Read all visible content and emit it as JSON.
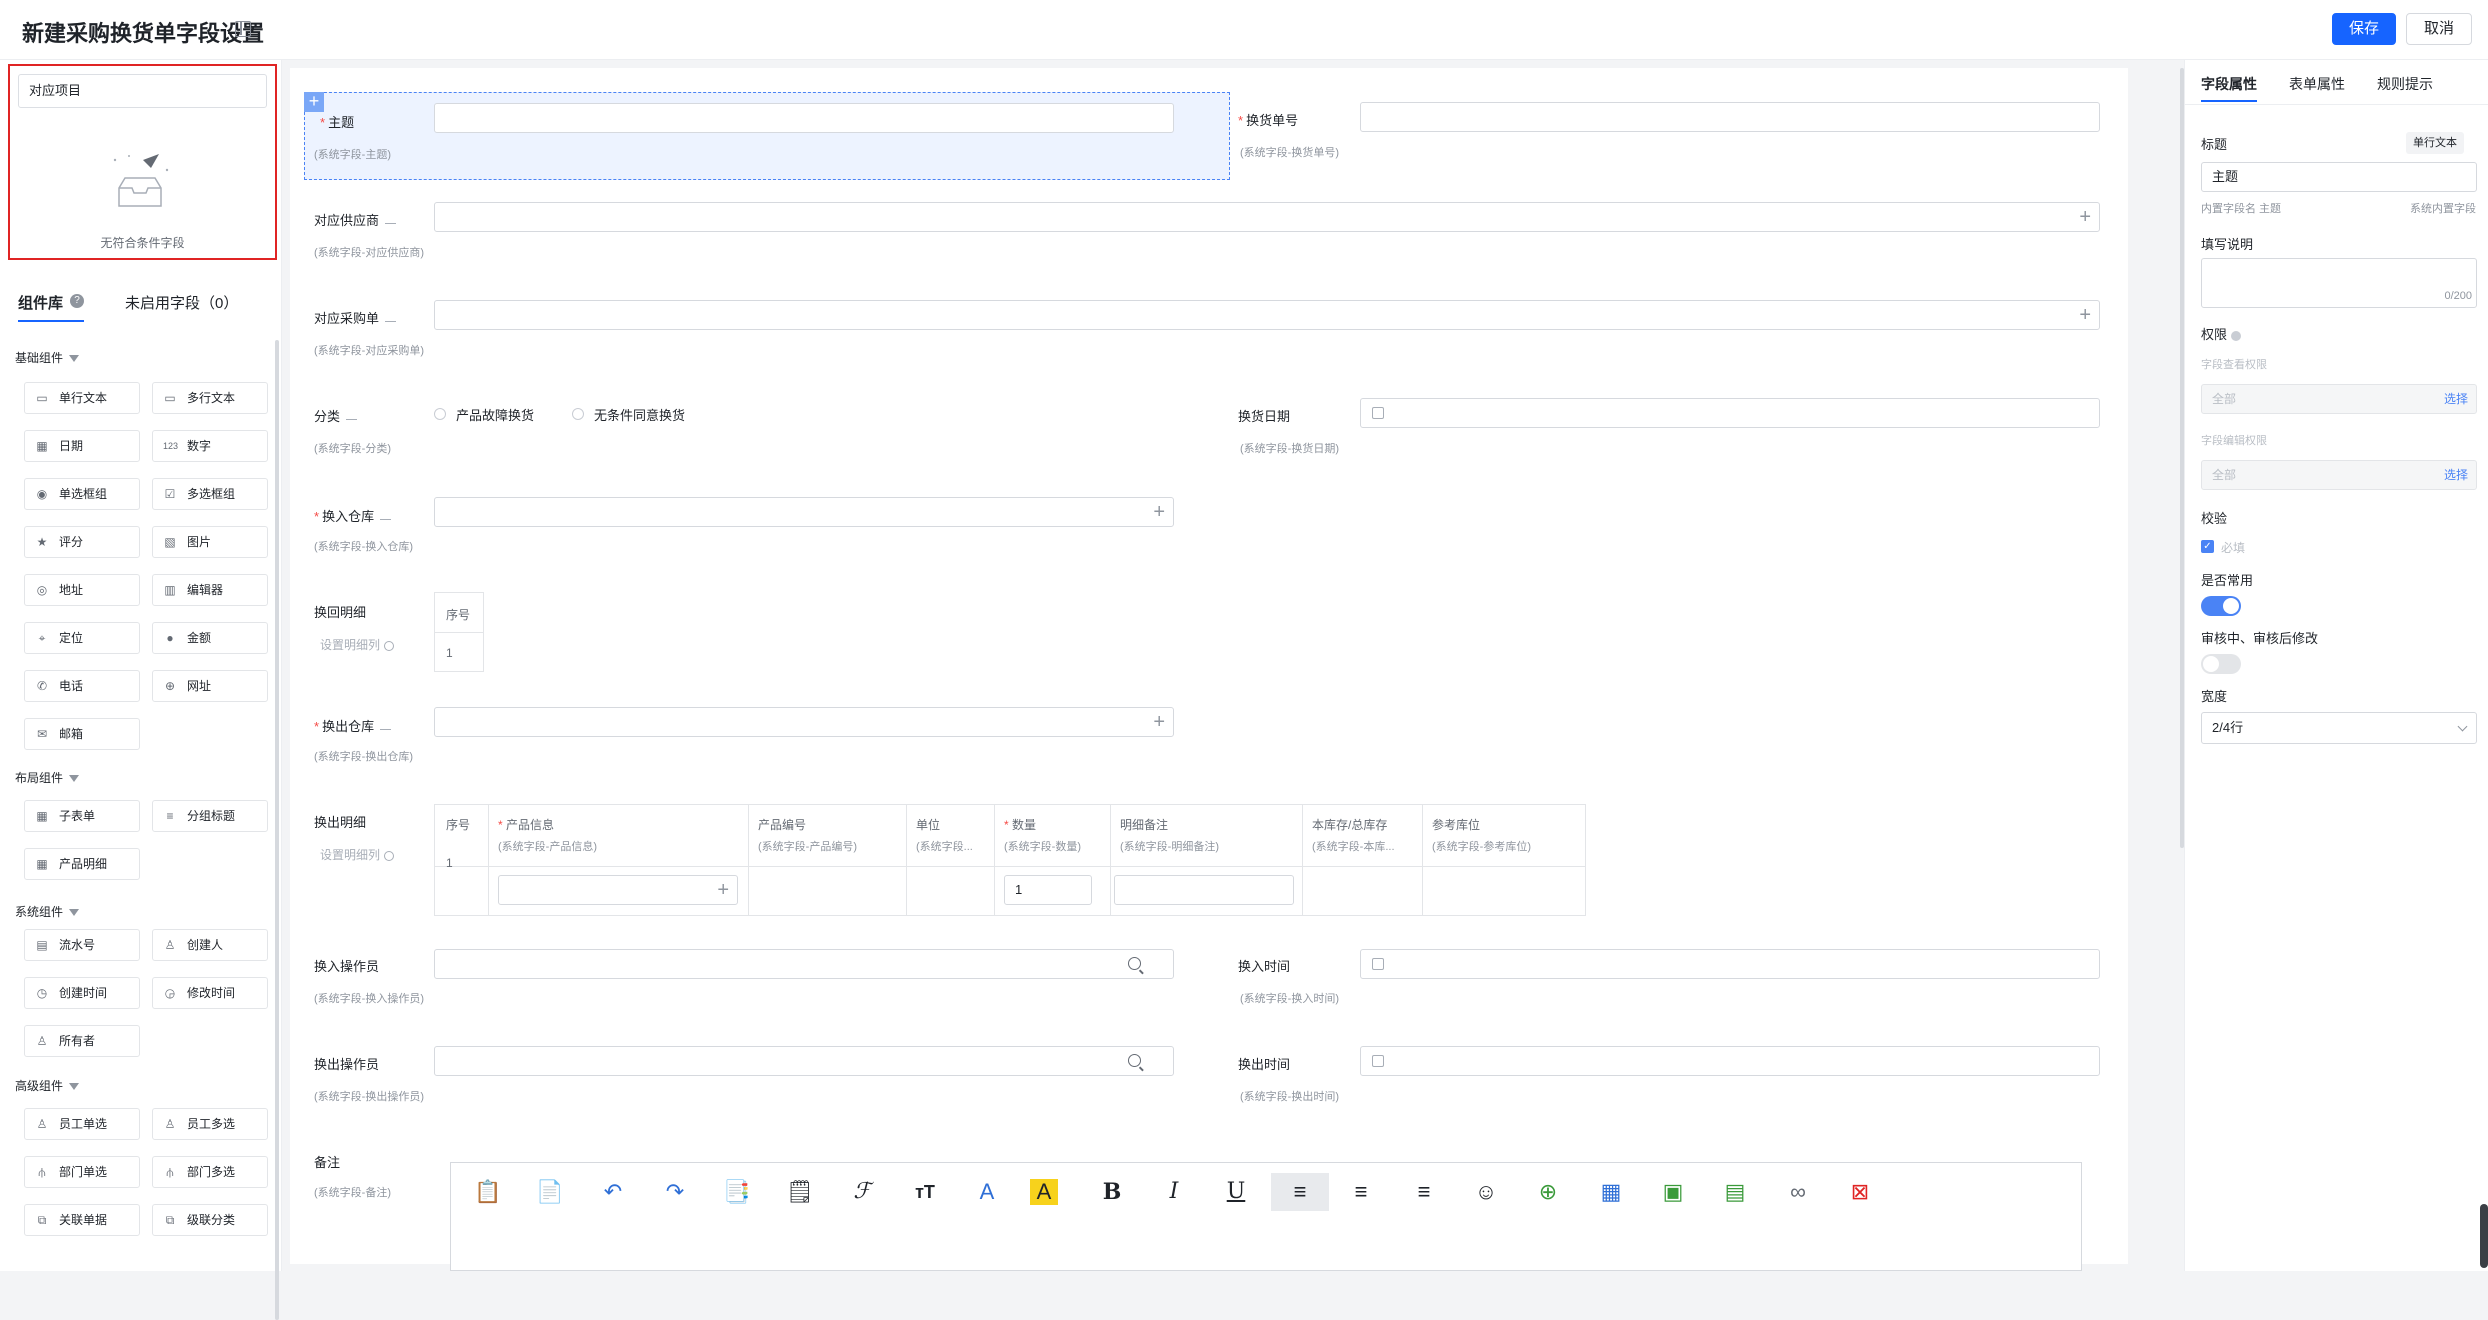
{
  "header": {
    "title": "新建采购换货单字段设置",
    "save": "保存",
    "cancel": "取消"
  },
  "left": {
    "search_value": "对应项目",
    "empty_text": "无符合条件字段",
    "tab_lib": "组件库",
    "tab_unused": "未启用字段（0）",
    "groups": {
      "basic": "基础组件",
      "layout": "布局组件",
      "system": "系统组件",
      "advanced": "高级组件"
    },
    "basic": [
      "单行文本",
      "多行文本",
      "日期",
      "数字",
      "单选框组",
      "多选框组",
      "评分",
      "图片",
      "地址",
      "编辑器",
      "定位",
      "金额",
      "电话",
      "网址",
      "邮箱"
    ],
    "layout": [
      "子表单",
      "分组标题",
      "产品明细"
    ],
    "system": [
      "流水号",
      "创建人",
      "创建时间",
      "修改时间",
      "所有者"
    ],
    "advanced": [
      "员工单选",
      "员工多选",
      "部门单选",
      "部门多选",
      "关联单据",
      "级联分类"
    ]
  },
  "form": {
    "subject": {
      "label": "主题",
      "sub": "(系统字段-主题)"
    },
    "exchange_no": {
      "label": "换货单号",
      "sub": "(系统字段-换货单号)"
    },
    "supplier": {
      "label": "对应供应商",
      "sub": "(系统字段-对应供应商)"
    },
    "po": {
      "label": "对应采购单",
      "sub": "(系统字段-对应采购单)"
    },
    "category": {
      "label": "分类",
      "sub": "(系统字段-分类)",
      "opt1": "产品故障换货",
      "opt2": "无条件同意换货"
    },
    "exchange_date": {
      "label": "换货日期",
      "sub": "(系统字段-换货日期)"
    },
    "in_wh": {
      "label": "换入仓库",
      "sub": "(系统字段-换入仓库)"
    },
    "return_detail": {
      "label": "换回明细",
      "link": "设置明细列",
      "col_no": "序号",
      "row1": "1"
    },
    "out_wh": {
      "label": "换出仓库",
      "sub": "(系统字段-换出仓库)"
    },
    "out_detail": {
      "label": "换出明细",
      "link": "设置明细列",
      "col_no": "序号",
      "row1": "1",
      "cols": [
        {
          "title": "产品信息",
          "sub": "(系统字段-产品信息)",
          "req": true
        },
        {
          "title": "产品编号",
          "sub": "(系统字段-产品编号)",
          "req": false
        },
        {
          "title": "单位",
          "sub": "(系统字段...",
          "req": false
        },
        {
          "title": "数量",
          "sub": "(系统字段-数量)",
          "req": true
        },
        {
          "title": "明细备注",
          "sub": "(系统字段-明细备注)",
          "req": false
        },
        {
          "title": "本库存/总库存",
          "sub": "(系统字段-本库...",
          "req": false
        },
        {
          "title": "参考库位",
          "sub": "(系统字段-参考库位)",
          "req": false
        }
      ],
      "qty": "1"
    },
    "in_operator": {
      "label": "换入操作员",
      "sub": "(系统字段-换入操作员)"
    },
    "in_time": {
      "label": "换入时间",
      "sub": "(系统字段-换入时间)"
    },
    "out_operator": {
      "label": "换出操作员",
      "sub": "(系统字段-换出操作员)"
    },
    "out_time": {
      "label": "换出时间",
      "sub": "(系统字段-换出时间)"
    },
    "remark": {
      "label": "备注",
      "sub": "(系统字段-备注)"
    }
  },
  "right": {
    "tabs": [
      "字段属性",
      "表单属性",
      "规则提示"
    ],
    "title_label": "标题",
    "badge": "单行文本",
    "title_value": "主题",
    "builtin_name": "内置字段名 主题",
    "builtin_tag": "系统内置字段",
    "desc_label": "填写说明",
    "desc_count": "0/200",
    "perm_label": "权限",
    "view_perm": "字段查看权限",
    "edit_perm": "字段编辑权限",
    "all": "全部",
    "choose": "选择",
    "verify_label": "校验",
    "required": "必填",
    "common_label": "是否常用",
    "review_label": "审核中、审核后修改",
    "width_label": "宽度",
    "width_value": "2/4行"
  }
}
